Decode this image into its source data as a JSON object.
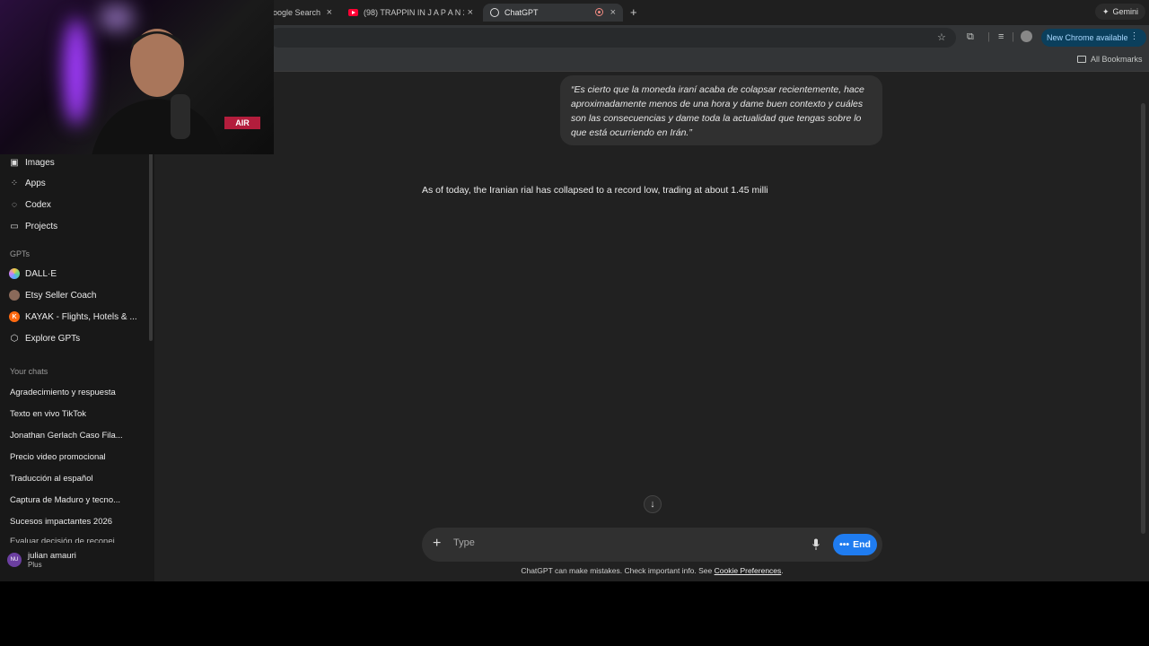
{
  "browser": {
    "tabs": [
      {
        "label": "Google Search",
        "partial": "oogle Search"
      },
      {
        "label": "(98) TRAPPIN IN  J A P A N  2"
      },
      {
        "label": "ChatGPT"
      }
    ],
    "gemini_label": "Gemini",
    "update_label": "New Chrome available",
    "all_bookmarks": "All Bookmarks"
  },
  "sidebar": {
    "nav": [
      {
        "label": "Images",
        "icon": "images-icon"
      },
      {
        "label": "Apps",
        "icon": "apps-icon"
      },
      {
        "label": "Codex",
        "icon": "codex-icon"
      },
      {
        "label": "Projects",
        "icon": "projects-icon"
      }
    ],
    "gpts_label": "GPTs",
    "gpts": [
      {
        "label": "DALL·E"
      },
      {
        "label": "Etsy Seller Coach"
      },
      {
        "label": "KAYAK - Flights, Hotels & ...",
        "avatar_letter": "K"
      },
      {
        "label": "Explore GPTs"
      }
    ],
    "chats_label": "Your chats",
    "chats": [
      "Agradecimiento y respuesta",
      "Texto en vivo TikTok",
      "Jonathan Gerlach Caso Fila...",
      "Precio video promocional",
      "Traducción al español",
      "Captura de Maduro y tecno...",
      "Sucesos impactantes 2026",
      "Evaluar decisión de reconei..."
    ],
    "user": {
      "initials": "NU",
      "name": "julian amauri",
      "plan": "Plus"
    }
  },
  "conversation": {
    "user_message": "“Es cierto que la moneda iraní acaba de colapsar recientemente, hace aproximadamente menos de una hora y dame buen contexto y cuáles son las consecuencias y dame toda la actualidad que tengas sobre lo que está ocurriendo en Irán.”",
    "assistant_message": "As of today, the Iranian rial has collapsed to a record low, trading at about 1.45 milli"
  },
  "composer": {
    "placeholder": "Type",
    "end_label": "End"
  },
  "disclaimer": {
    "text": "ChatGPT can make mistakes. Check important info. See ",
    "link": "Cookie Preferences",
    "suffix": "."
  },
  "webcam": {
    "sign_text": "AIR"
  },
  "colors": {
    "accent": "#1f7cf0",
    "sidebar_bg": "#181818",
    "main_bg": "#212121"
  }
}
